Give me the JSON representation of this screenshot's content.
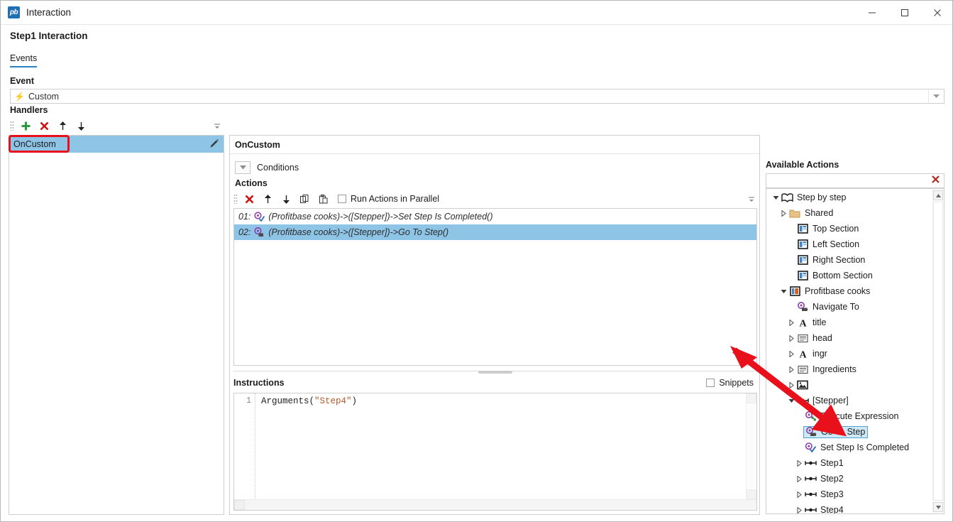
{
  "window": {
    "title": "Interaction",
    "app_icon": "pb",
    "minimize": "minimize-icon",
    "maximize": "maximize-icon",
    "close": "close-icon"
  },
  "header": {
    "page_title": "Step1 Interaction",
    "tabs": [
      {
        "label": "Events",
        "active": true
      }
    ]
  },
  "event_section": {
    "label": "Event",
    "icon": "lightning-bolt-icon",
    "value": "Custom",
    "dropdown_icon": "chevron-down-icon"
  },
  "handlers_section": {
    "label": "Handlers",
    "toolbar": [
      {
        "name": "add-handler-button",
        "icon": "plus-icon",
        "label": "+"
      },
      {
        "name": "delete-handler-button",
        "icon": "x-icon",
        "label": "✕"
      },
      {
        "name": "move-handler-up-button",
        "icon": "arrow-up-icon",
        "label": "↑"
      },
      {
        "name": "move-handler-down-button",
        "icon": "arrow-down-icon",
        "label": "↓"
      }
    ],
    "overflow_icon": "toolbar-overflow-icon",
    "items": [
      {
        "label": "OnCustom",
        "selected": true,
        "edit_icon": "pencil-icon"
      }
    ]
  },
  "center_pane": {
    "title": "OnCustom",
    "conditions": {
      "label": "Conditions",
      "collapse_icon": "triangle-down-icon"
    },
    "actions": {
      "label": "Actions",
      "toolbar": [
        {
          "name": "delete-action-button",
          "icon": "x-icon",
          "label": "✕"
        },
        {
          "name": "move-action-up-button",
          "icon": "arrow-up-icon",
          "label": "↑"
        },
        {
          "name": "move-action-down-button",
          "icon": "arrow-down-icon",
          "label": "↓"
        },
        {
          "name": "copy-action-button",
          "icon": "copy-icon",
          "label": ""
        },
        {
          "name": "paste-action-button",
          "icon": "paste-icon",
          "label": ""
        }
      ],
      "run_parallel": {
        "label": "Run Actions in Parallel",
        "checked": false
      },
      "overflow_icon": "toolbar-overflow-icon",
      "rows": [
        {
          "index": "01:",
          "icon": "set-step-completed-icon",
          "text": "(Profitbase cooks)->([Stepper])->Set Step Is Completed()",
          "selected": false
        },
        {
          "index": "02:",
          "icon": "go-to-step-icon",
          "text": "(Profitbase cooks)->([Stepper])->Go To Step()",
          "selected": true
        }
      ]
    },
    "instructions": {
      "label": "Instructions",
      "snippets": {
        "label": "Snippets",
        "checked": false
      },
      "lines": [
        {
          "number": "1",
          "prefix": "Arguments(",
          "string": "\"Step4\"",
          "suffix": ")"
        }
      ]
    }
  },
  "available_actions": {
    "title": "Available Actions",
    "search": {
      "value": "",
      "placeholder": "",
      "clear_icon": "red-x-icon"
    },
    "tree": [
      {
        "depth": 0,
        "twisty": "expanded",
        "icon": "book-icon",
        "label": "Step by step",
        "selected": false
      },
      {
        "depth": 1,
        "twisty": "collapsed",
        "icon": "folder-icon",
        "label": "Shared",
        "selected": false
      },
      {
        "depth": 2,
        "twisty": "none",
        "icon": "section-icon",
        "label": "Top Section",
        "selected": false
      },
      {
        "depth": 2,
        "twisty": "none",
        "icon": "section-icon",
        "label": "Left Section",
        "selected": false
      },
      {
        "depth": 2,
        "twisty": "none",
        "icon": "section-icon",
        "label": "Right Section",
        "selected": false
      },
      {
        "depth": 2,
        "twisty": "none",
        "icon": "section-icon",
        "label": "Bottom Section",
        "selected": false
      },
      {
        "depth": 1,
        "twisty": "expanded",
        "icon": "page-icon",
        "label": "Profitbase cooks",
        "selected": false
      },
      {
        "depth": 2,
        "twisty": "none",
        "icon": "navigate-to-icon",
        "label": "Navigate To",
        "selected": false
      },
      {
        "depth": 2,
        "twisty": "collapsed",
        "icon": "text-a-icon",
        "label": "title",
        "selected": false
      },
      {
        "depth": 2,
        "twisty": "collapsed",
        "icon": "header-icon",
        "label": "head",
        "selected": false
      },
      {
        "depth": 2,
        "twisty": "collapsed",
        "icon": "text-a-icon",
        "label": "ingr",
        "selected": false
      },
      {
        "depth": 2,
        "twisty": "collapsed",
        "icon": "header-icon",
        "label": "Ingredients",
        "selected": false
      },
      {
        "depth": 2,
        "twisty": "collapsed",
        "icon": "image-icon",
        "label": "",
        "selected": false
      },
      {
        "depth": 2,
        "twisty": "expanded",
        "icon": "stepper-icon",
        "label": "[Stepper]",
        "selected": false
      },
      {
        "depth": 3,
        "twisty": "none",
        "icon": "execute-expression-icon",
        "label": "Execute Expression",
        "selected": false
      },
      {
        "depth": 3,
        "twisty": "none",
        "icon": "go-to-step-icon",
        "label": "Go To Step",
        "selected": true
      },
      {
        "depth": 3,
        "twisty": "none",
        "icon": "set-step-completed-icon",
        "label": "Set Step Is Completed",
        "selected": false
      },
      {
        "depth": 3,
        "twisty": "collapsed",
        "icon": "stepper-icon",
        "label": "Step1",
        "selected": false
      },
      {
        "depth": 3,
        "twisty": "collapsed",
        "icon": "stepper-icon",
        "label": "Step2",
        "selected": false
      },
      {
        "depth": 3,
        "twisty": "collapsed",
        "icon": "stepper-icon",
        "label": "Step3",
        "selected": false
      },
      {
        "depth": 3,
        "twisty": "collapsed",
        "icon": "stepper-icon",
        "label": "Step4",
        "selected": false
      }
    ],
    "scroll_up_icon": "scroll-up-icon",
    "scroll_down_icon": "scroll-down-icon"
  },
  "annotations": {
    "highlight_rect_target": "OnCustom",
    "arrow_target": "Go To Step",
    "color": "#e8111b"
  }
}
